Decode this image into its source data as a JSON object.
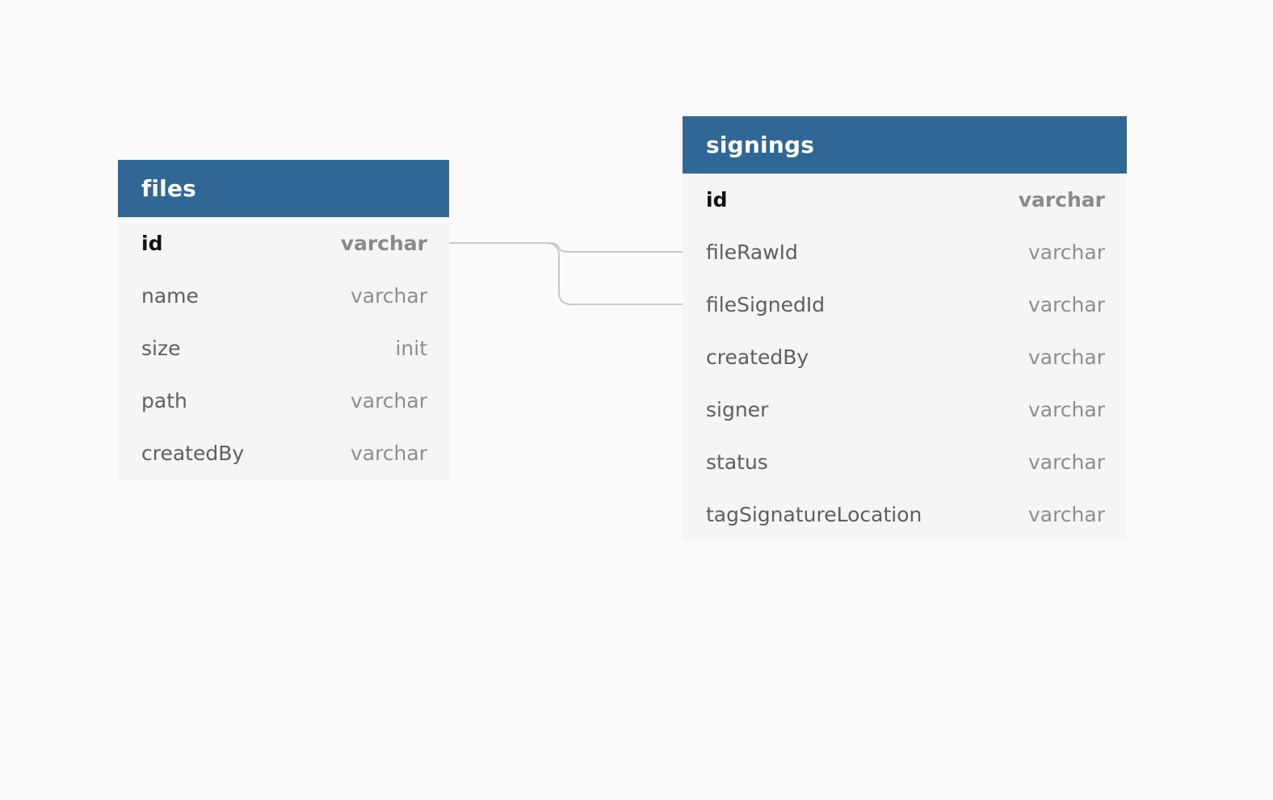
{
  "diagram": {
    "tables": [
      {
        "name": "files",
        "fields": [
          {
            "name": "id",
            "type": "varchar",
            "pk": true
          },
          {
            "name": "name",
            "type": "varchar"
          },
          {
            "name": "size",
            "type": "init"
          },
          {
            "name": "path",
            "type": "varchar"
          },
          {
            "name": "createdBy",
            "type": "varchar"
          }
        ]
      },
      {
        "name": "signings",
        "fields": [
          {
            "name": "id",
            "type": "varchar",
            "pk": true
          },
          {
            "name": "fileRawId",
            "type": "varchar"
          },
          {
            "name": "fileSignedId",
            "type": "varchar"
          },
          {
            "name": "createdBy",
            "type": "varchar"
          },
          {
            "name": "signer",
            "type": "varchar"
          },
          {
            "name": "status",
            "type": "varchar"
          },
          {
            "name": "tagSignatureLocation",
            "type": "varchar"
          }
        ]
      }
    ],
    "relations": [
      {
        "from": "files.id",
        "to": "signings.fileRawId"
      },
      {
        "from": "files.id",
        "to": "signings.fileSignedId"
      }
    ],
    "colors": {
      "header": "#306794",
      "table_body": "#f5f5f5",
      "background": "#fafafa",
      "connector": "#c8c8c8"
    }
  }
}
